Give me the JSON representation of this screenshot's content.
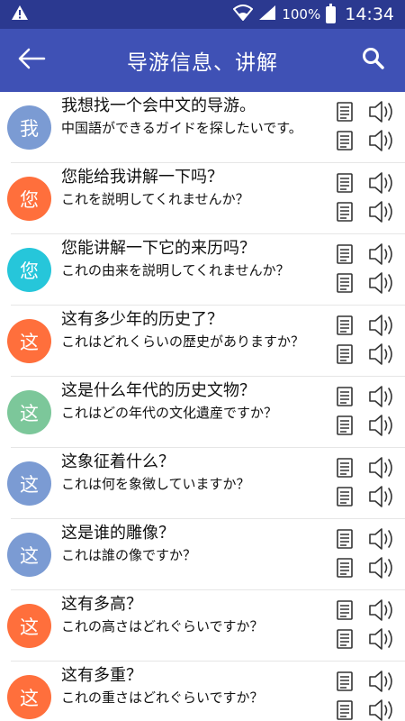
{
  "status": {
    "battery": "100%",
    "time": "14:34"
  },
  "header": {
    "title": "导游信息、讲解"
  },
  "colors": {
    "status_bar": "#2b3990",
    "app_bar": "#3f51b5"
  },
  "phrases": [
    {
      "avatar": "我",
      "color": "#7b9bd3",
      "zh": "我想找一个会中文的导游。",
      "ja": "中国語ができるガイドを探したいです。"
    },
    {
      "avatar": "您",
      "color": "#ff6f3c",
      "zh": "您能给我讲解一下吗？",
      "ja": "これを説明してくれませんか？"
    },
    {
      "avatar": "您",
      "color": "#26c6da",
      "zh": "您能讲解一下它的来历吗？",
      "ja": "これの由来を説明してくれませんか？"
    },
    {
      "avatar": "这",
      "color": "#ff6f3c",
      "zh": "这有多少年的历史了？",
      "ja": "これはどれくらいの歴史がありますか？"
    },
    {
      "avatar": "这",
      "color": "#7cc79a",
      "zh": "这是什么年代的历史文物？",
      "ja": "これはどの年代の文化遺産ですか？"
    },
    {
      "avatar": "这",
      "color": "#7b9bd3",
      "zh": "这象征着什么？",
      "ja": "これは何を象徴していますか？"
    },
    {
      "avatar": "这",
      "color": "#7b9bd3",
      "zh": "这是谁的雕像？",
      "ja": "これは誰の像ですか？"
    },
    {
      "avatar": "这",
      "color": "#ff6f3c",
      "zh": "这有多高？",
      "ja": "これの高さはどれぐらいですか？"
    },
    {
      "avatar": "这",
      "color": "#ff6f3c",
      "zh": "这有多重？",
      "ja": "これの重さはどれぐらいですか？"
    }
  ]
}
